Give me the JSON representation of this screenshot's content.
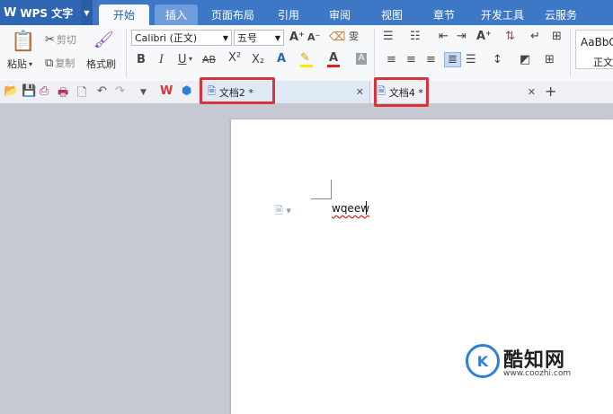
{
  "app": {
    "name": "WPS 文字",
    "logo": "W"
  },
  "ribbon_tabs": [
    "开始",
    "插入",
    "页面布局",
    "引用",
    "审阅",
    "视图",
    "章节",
    "开发工具",
    "云服务"
  ],
  "clipboard": {
    "paste": "粘贴",
    "cut": "剪切",
    "copy": "复制",
    "format_painter": "格式刷"
  },
  "font": {
    "name": "Calibri (正文)",
    "size": "五号",
    "bold": "B",
    "italic": "I",
    "underline": "U",
    "strike": "AB",
    "superscript": "X²",
    "subscript": "X₂",
    "grow": "A⁺",
    "shrink": "A⁻",
    "phonetic": "雯",
    "color": "A"
  },
  "styles": {
    "preview": "AaBbC",
    "name": "正文"
  },
  "doc_tabs": [
    {
      "label": "文档2 *"
    },
    {
      "label": "文档4 *"
    }
  ],
  "document": {
    "text": "wqeew"
  },
  "watermark": {
    "mark": "K",
    "name": "酷知网",
    "url": "www.coozhi.com"
  },
  "colors": {
    "ribbon": "#3c78c5",
    "highlight": "#d9343b",
    "page": "#ffffff",
    "workspace": "#c6c9d1"
  }
}
